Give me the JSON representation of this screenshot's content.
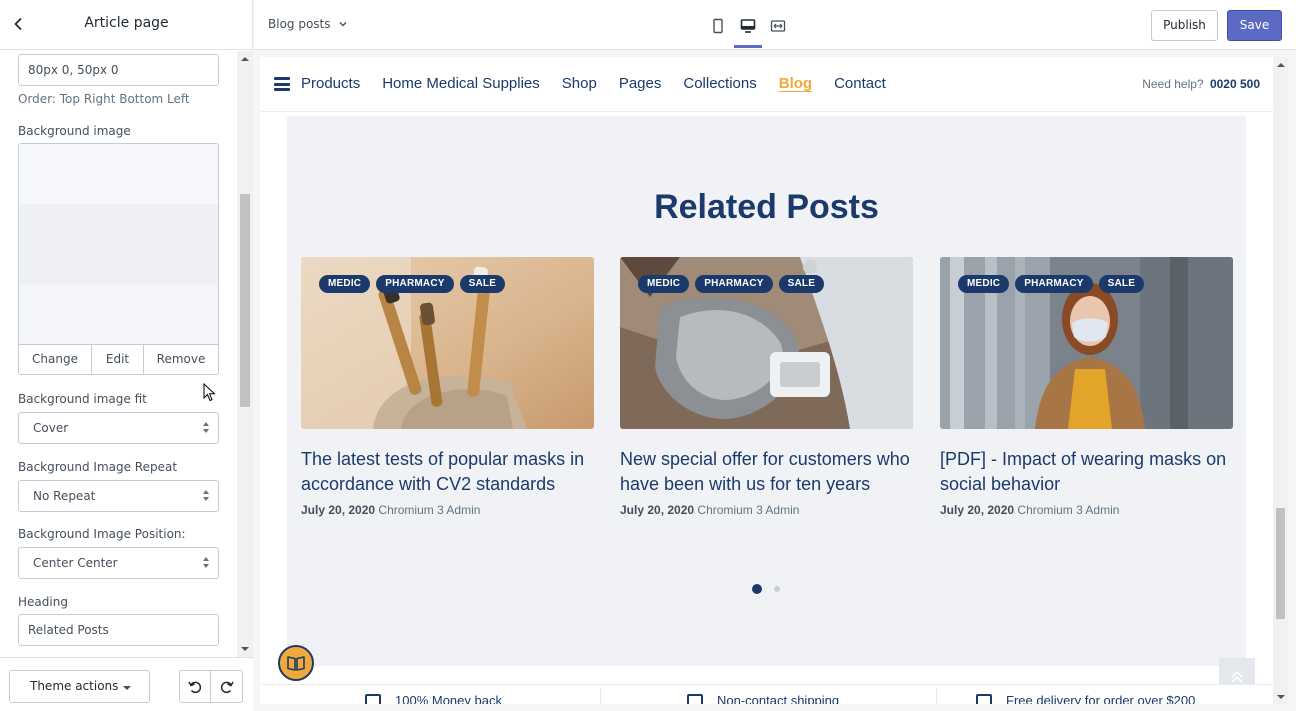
{
  "editor": {
    "title": "Article page",
    "padding_value": "80px 0, 50px 0",
    "padding_hint": "Order: Top Right Bottom Left",
    "bg_image_label": "Background image",
    "bg_actions": [
      "Change",
      "Edit",
      "Remove"
    ],
    "bg_fit_label": "Background image fit",
    "bg_fit_value": "Cover",
    "bg_repeat_label": "Background Image Repeat",
    "bg_repeat_value": "No Repeat",
    "bg_position_label": "Background Image Position:",
    "bg_position_value": "Center Center",
    "heading_label": "Heading",
    "heading_value": "Related Posts",
    "theme_actions": "Theme actions"
  },
  "topbar": {
    "page_selector": "Blog posts",
    "devices": [
      "mobile-icon",
      "desktop-icon",
      "fullwidth-icon"
    ],
    "active_device": "desktop-icon",
    "publish": "Publish",
    "save": "Save",
    "accent_color": "#5c6ac4"
  },
  "nav": {
    "links": [
      "Products",
      "Home Medical Supplies",
      "Shop",
      "Pages",
      "Collections",
      "Blog",
      "Contact"
    ],
    "active": "Blog",
    "help_text": "Need help?",
    "phone": "0020 500",
    "brand_color": "#1b3a6b",
    "active_color": "#f2a93b"
  },
  "related": {
    "heading": "Related Posts",
    "posts": [
      {
        "tags": [
          "MEDIC",
          "PHARMACY",
          "SALE"
        ],
        "title": "The latest tests of popular masks in accordance with CV2 standards",
        "date": "July 20, 2020",
        "author": "Chromium 3 Admin"
      },
      {
        "tags": [
          "MEDIC",
          "PHARMACY",
          "SALE"
        ],
        "title": "New special offer for customers who have been with us for ten years",
        "date": "July 20, 2020",
        "author": "Chromium 3 Admin"
      },
      {
        "tags": [
          "MEDIC",
          "PHARMACY",
          "SALE"
        ],
        "title": "[PDF] - Impact of wearing masks on social behavior",
        "date": "July 20, 2020",
        "author": "Chromium 3 Admin"
      }
    ],
    "carousel_pages": 2,
    "carousel_active": 1
  },
  "footer_strip": {
    "items": [
      "100% Money back",
      "Non-contact shipping",
      "Free delivery for order over $200"
    ]
  }
}
